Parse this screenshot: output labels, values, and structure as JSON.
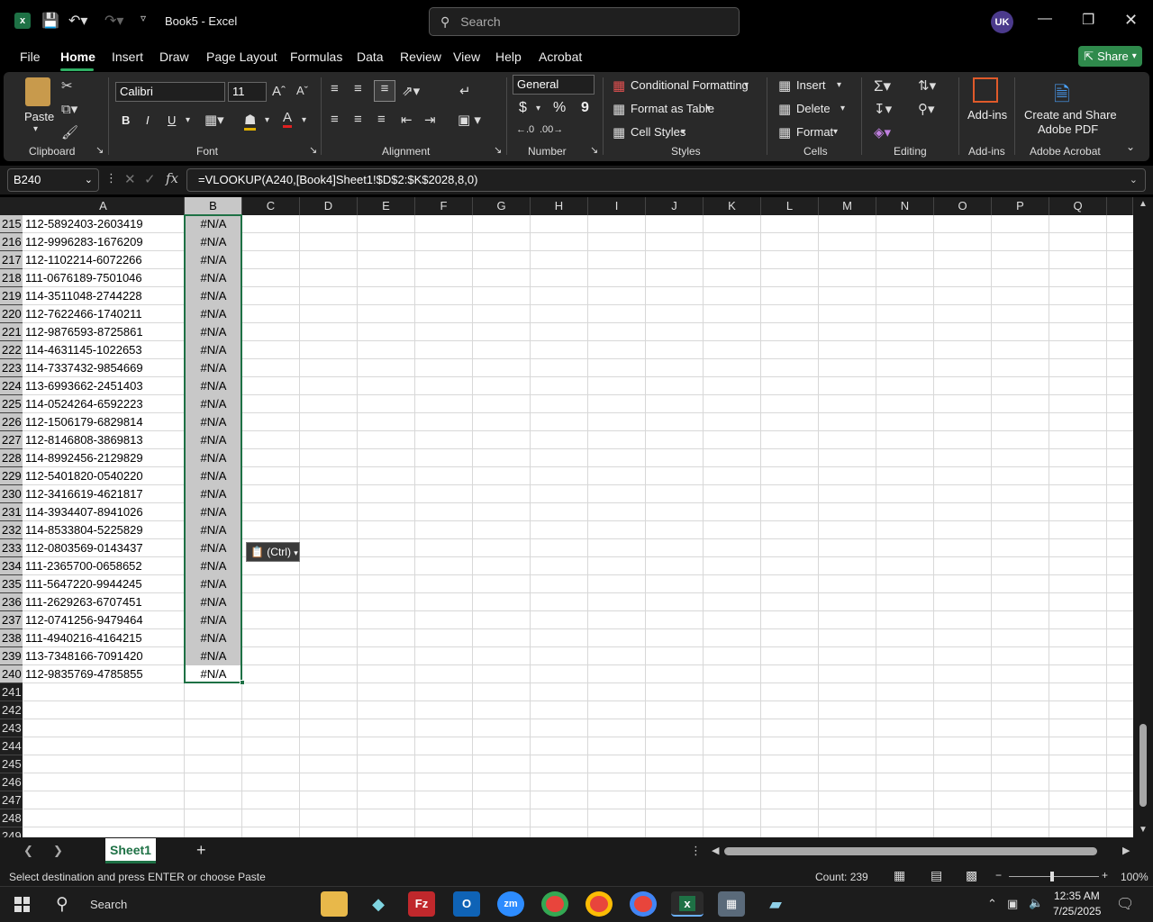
{
  "window": {
    "title": "Book5  -  Excel",
    "search_placeholder": "Search",
    "avatar": "UK"
  },
  "menu": [
    "File",
    "Home",
    "Insert",
    "Draw",
    "Page Layout",
    "Formulas",
    "Data",
    "Review",
    "View",
    "Help",
    "Acrobat"
  ],
  "share_label": "Share",
  "ribbon": {
    "clipboard": {
      "paste": "Paste",
      "label": "Clipboard"
    },
    "font": {
      "name": "Calibri",
      "size": "11",
      "bold": "B",
      "italic": "I",
      "underline": "U",
      "label": "Font"
    },
    "alignment": {
      "label": "Alignment"
    },
    "number": {
      "format": "General",
      "currency": "$",
      "percent": "%",
      "comma": "9",
      "label": "Number"
    },
    "styles": {
      "conditional": "Conditional Formatting",
      "table": "Format as Table",
      "cell": "Cell Styles",
      "label": "Styles"
    },
    "cells": {
      "insert": "Insert",
      "delete": "Delete",
      "format": "Format",
      "label": "Cells"
    },
    "editing": {
      "label": "Editing"
    },
    "addins": {
      "button": "Add-ins",
      "label": "Add-ins"
    },
    "acrobat": {
      "button_line1": "Create and Share",
      "button_line2": "Adobe PDF",
      "label": "Adobe Acrobat"
    }
  },
  "formula": {
    "cell_ref": "B240",
    "fx": "fx",
    "content": "=VLOOKUP(A240,[Book4]Sheet1!$D$2:$K$2028,8,0)"
  },
  "columns": [
    "A",
    "B",
    "C",
    "D",
    "E",
    "F",
    "G",
    "H",
    "I",
    "J",
    "K",
    "L",
    "M",
    "N",
    "O",
    "P",
    "Q"
  ],
  "rows": [
    {
      "n": "215",
      "a": "112-5892403-2603419",
      "b": "#N/A"
    },
    {
      "n": "216",
      "a": "112-9996283-1676209",
      "b": "#N/A"
    },
    {
      "n": "217",
      "a": "112-1102214-6072266",
      "b": "#N/A"
    },
    {
      "n": "218",
      "a": "111-0676189-7501046",
      "b": "#N/A"
    },
    {
      "n": "219",
      "a": "114-3511048-2744228",
      "b": "#N/A"
    },
    {
      "n": "220",
      "a": "112-7622466-1740211",
      "b": "#N/A"
    },
    {
      "n": "221",
      "a": "112-9876593-8725861",
      "b": "#N/A"
    },
    {
      "n": "222",
      "a": "114-4631145-1022653",
      "b": "#N/A"
    },
    {
      "n": "223",
      "a": "114-7337432-9854669",
      "b": "#N/A"
    },
    {
      "n": "224",
      "a": "113-6993662-2451403",
      "b": "#N/A"
    },
    {
      "n": "225",
      "a": "114-0524264-6592223",
      "b": "#N/A"
    },
    {
      "n": "226",
      "a": "112-1506179-6829814",
      "b": "#N/A"
    },
    {
      "n": "227",
      "a": "112-8146808-3869813",
      "b": "#N/A"
    },
    {
      "n": "228",
      "a": "114-8992456-2129829",
      "b": "#N/A"
    },
    {
      "n": "229",
      "a": "112-5401820-0540220",
      "b": "#N/A"
    },
    {
      "n": "230",
      "a": "112-3416619-4621817",
      "b": "#N/A"
    },
    {
      "n": "231",
      "a": "114-3934407-8941026",
      "b": "#N/A"
    },
    {
      "n": "232",
      "a": "114-8533804-5225829",
      "b": "#N/A"
    },
    {
      "n": "233",
      "a": "112-0803569-0143437",
      "b": "#N/A"
    },
    {
      "n": "234",
      "a": "111-2365700-0658652",
      "b": "#N/A"
    },
    {
      "n": "235",
      "a": "111-5647220-9944245",
      "b": "#N/A"
    },
    {
      "n": "236",
      "a": "111-2629263-6707451",
      "b": "#N/A"
    },
    {
      "n": "237",
      "a": "112-0741256-9479464",
      "b": "#N/A"
    },
    {
      "n": "238",
      "a": "111-4940216-4164215",
      "b": "#N/A"
    },
    {
      "n": "239",
      "a": "113-7348166-7091420",
      "b": "#N/A"
    },
    {
      "n": "240",
      "a": "112-9835769-4785855",
      "b": "#N/A"
    },
    {
      "n": "241",
      "a": "",
      "b": ""
    },
    {
      "n": "242",
      "a": "",
      "b": ""
    },
    {
      "n": "243",
      "a": "",
      "b": ""
    },
    {
      "n": "244",
      "a": "",
      "b": ""
    },
    {
      "n": "245",
      "a": "",
      "b": ""
    },
    {
      "n": "246",
      "a": "",
      "b": ""
    },
    {
      "n": "247",
      "a": "",
      "b": ""
    },
    {
      "n": "248",
      "a": "",
      "b": ""
    },
    {
      "n": "249",
      "a": "",
      "b": ""
    }
  ],
  "paste_tag": "(Ctrl)",
  "sheet_tab": "Sheet1",
  "status": {
    "message": "Select destination and press ENTER or choose Paste",
    "count": "Count: 239",
    "zoom": "100%"
  },
  "taskbar": {
    "search": "Search",
    "time": "12:35 AM",
    "date": "7/25/2025"
  },
  "colors": {
    "excel_green": "#1e7145",
    "share_green": "#2f8a4c",
    "selection_border": "#1e7145"
  }
}
